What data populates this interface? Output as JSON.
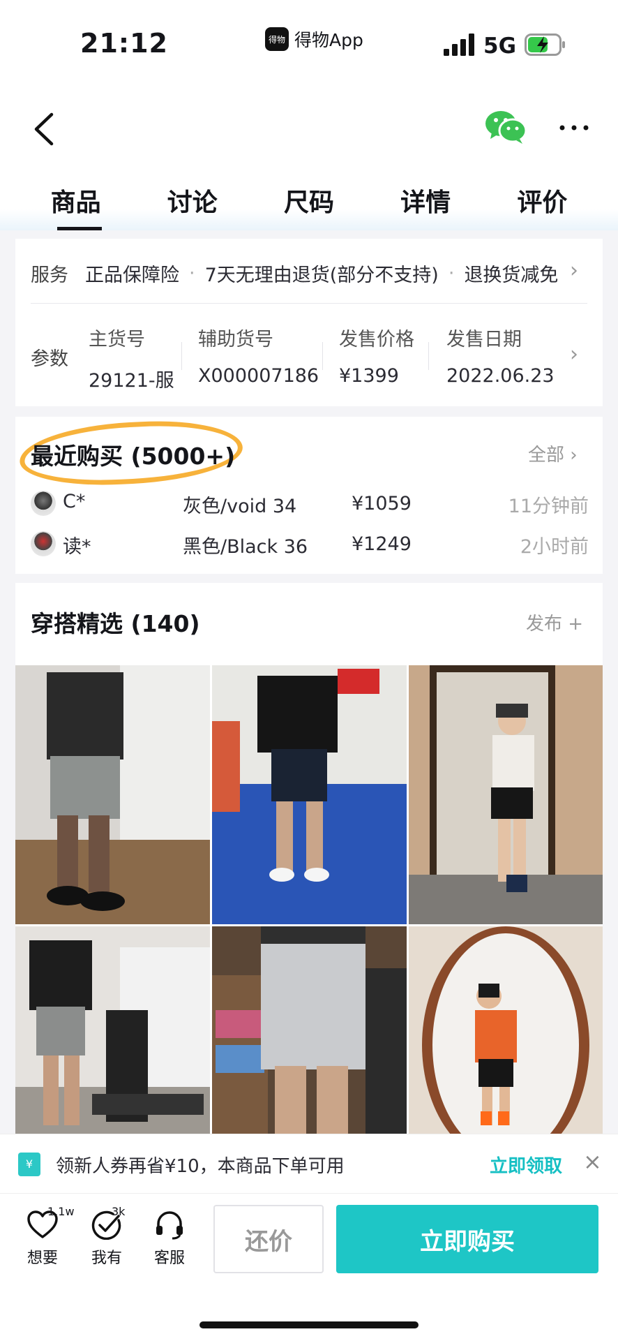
{
  "status_bar": {
    "time": "21:12",
    "app": "得物App",
    "logo_text": "得物",
    "network": "5G"
  },
  "tabs": [
    "商品",
    "讨论",
    "尺码",
    "详情",
    "评价"
  ],
  "service": {
    "label": "服务",
    "items": [
      "正品保障险",
      "7天无理由退货(部分不支持)",
      "退换货减免"
    ]
  },
  "params": {
    "label": "参数",
    "cols": [
      {
        "label": "主货号",
        "value": "29121-服"
      },
      {
        "label": "辅助货号",
        "value": "X000007186"
      },
      {
        "label": "发售价格",
        "value": "¥1399"
      },
      {
        "label": "发售日期",
        "value": "2022.06.23"
      }
    ]
  },
  "recent": {
    "title": "最近购买 (5000+)",
    "all": "全部",
    "rows": [
      {
        "name": "C*",
        "spec": "灰色/void 34",
        "price": "¥1059",
        "time": "11分钟前"
      },
      {
        "name": "读*",
        "spec": "黑色/Black 36",
        "price": "¥1249",
        "time": "2小时前"
      }
    ]
  },
  "outfit": {
    "title": "穿搭精选 (140)",
    "publish": "发布 +"
  },
  "coupon": {
    "icon_text": "¥",
    "text": "领新人券再省¥10，本商品下单可用",
    "action": "立即领取",
    "close": "×"
  },
  "bottom": {
    "want": {
      "label": "想要",
      "count": "1.1w"
    },
    "have": {
      "label": "我有",
      "count": "3k"
    },
    "service": {
      "label": "客服"
    },
    "bargain": "还价",
    "buy": "立即购买"
  },
  "colors": {
    "accent": "#1ec6c6",
    "highlight_circle": "#f7b23b"
  }
}
